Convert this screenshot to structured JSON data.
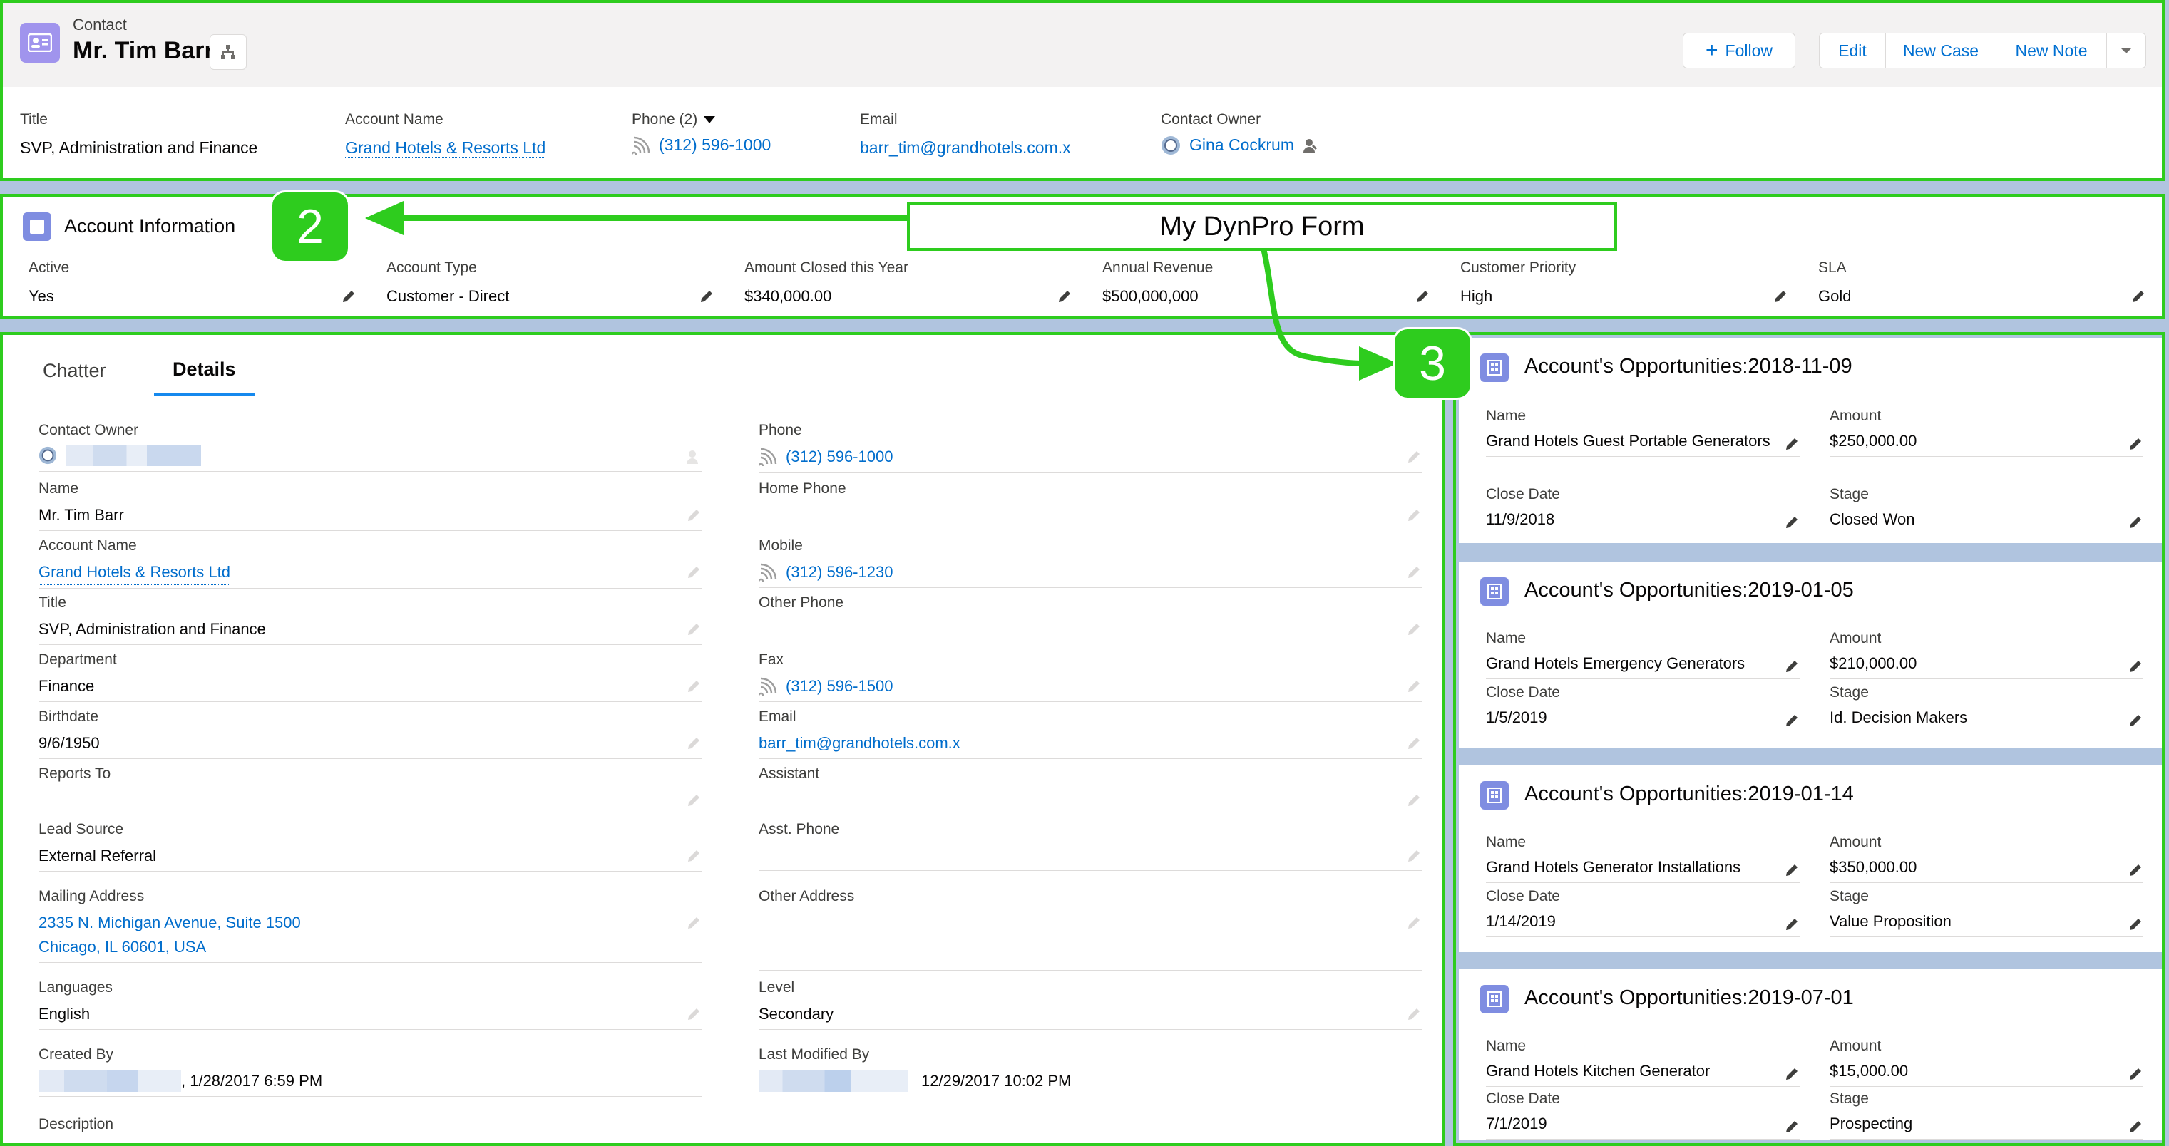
{
  "header": {
    "object_label": "Contact",
    "record_title": "Mr. Tim Barr",
    "buttons": {
      "follow": "Follow",
      "edit": "Edit",
      "new_case": "New Case",
      "new_note": "New Note"
    },
    "highlights": {
      "title": {
        "label": "Title",
        "value": "SVP, Administration and Finance"
      },
      "account_name": {
        "label": "Account Name",
        "value": "Grand Hotels & Resorts Ltd"
      },
      "phone": {
        "label": "Phone (2)",
        "value": "(312) 596-1000"
      },
      "email": {
        "label": "Email",
        "value": "barr_tim@grandhotels.com.x"
      },
      "owner": {
        "label": "Contact Owner",
        "value": "Gina Cockrum"
      }
    }
  },
  "account_info": {
    "title": "Account Information",
    "fields": [
      {
        "label": "Active",
        "value": "Yes"
      },
      {
        "label": "Account Type",
        "value": "Customer - Direct"
      },
      {
        "label": "Amount Closed this Year",
        "value": "$340,000.00"
      },
      {
        "label": "Annual Revenue",
        "value": "$500,000,000"
      },
      {
        "label": "Customer Priority",
        "value": "High"
      },
      {
        "label": "SLA",
        "value": "Gold"
      }
    ]
  },
  "annotations": {
    "badge_2": "2",
    "badge_3": "3",
    "dynpro_label": "My DynPro Form"
  },
  "tabs": {
    "chatter": "Chatter",
    "details": "Details"
  },
  "details": {
    "contact_owner": {
      "label": "Contact Owner",
      "value": ""
    },
    "phone": {
      "label": "Phone",
      "value": "(312) 596-1000"
    },
    "name": {
      "label": "Name",
      "value": "Mr. Tim Barr"
    },
    "home_phone": {
      "label": "Home Phone",
      "value": ""
    },
    "account_name": {
      "label": "Account Name",
      "value": "Grand Hotels & Resorts Ltd"
    },
    "mobile": {
      "label": "Mobile",
      "value": "(312) 596-1230"
    },
    "title": {
      "label": "Title",
      "value": "SVP, Administration and Finance"
    },
    "other_phone": {
      "label": "Other Phone",
      "value": ""
    },
    "department": {
      "label": "Department",
      "value": "Finance"
    },
    "fax": {
      "label": "Fax",
      "value": "(312) 596-1500"
    },
    "birthdate": {
      "label": "Birthdate",
      "value": "9/6/1950"
    },
    "email": {
      "label": "Email",
      "value": "barr_tim@grandhotels.com.x"
    },
    "reports_to": {
      "label": "Reports To",
      "value": ""
    },
    "assistant": {
      "label": "Assistant",
      "value": ""
    },
    "lead_source": {
      "label": "Lead Source",
      "value": "External Referral"
    },
    "asst_phone": {
      "label": "Asst. Phone",
      "value": ""
    },
    "mailing_address": {
      "label": "Mailing Address",
      "line1": "2335 N. Michigan Avenue, Suite 1500",
      "line2": "Chicago, IL 60601, USA"
    },
    "other_address": {
      "label": "Other Address",
      "value": ""
    },
    "languages": {
      "label": "Languages",
      "value": "English"
    },
    "level": {
      "label": "Level",
      "value": "Secondary"
    },
    "created_by": {
      "label": "Created By",
      "value": ", 1/28/2017 6:59 PM"
    },
    "last_modified_by": {
      "label": "Last Modified By",
      "value": "12/29/2017 10:02 PM"
    },
    "description": {
      "label": "Description"
    }
  },
  "opportunities": [
    {
      "title": "Account's Opportunities:2018-11-09",
      "name": "Grand Hotels Guest Portable Generators",
      "amount": "$250,000.00",
      "close_date": "11/9/2018",
      "stage": "Closed Won"
    },
    {
      "title": "Account's Opportunities:2019-01-05",
      "name": "Grand Hotels Emergency Generators",
      "amount": "$210,000.00",
      "close_date": "1/5/2019",
      "stage": "Id. Decision Makers"
    },
    {
      "title": "Account's Opportunities:2019-01-14",
      "name": "Grand Hotels Generator Installations",
      "amount": "$350,000.00",
      "close_date": "1/14/2019",
      "stage": "Value Proposition"
    },
    {
      "title": "Account's Opportunities:2019-07-01",
      "name": "Grand Hotels Kitchen Generator",
      "amount": "$15,000.00",
      "close_date": "7/1/2019",
      "stage": "Prospecting"
    }
  ],
  "opp_labels": {
    "name": "Name",
    "amount": "Amount",
    "close_date": "Close Date",
    "stage": "Stage"
  },
  "colors": {
    "annotation_green": "#2ecc1e",
    "link_blue": "#006dcc",
    "contact_icon": "#a094ed",
    "account_icon": "#7f8de1"
  }
}
